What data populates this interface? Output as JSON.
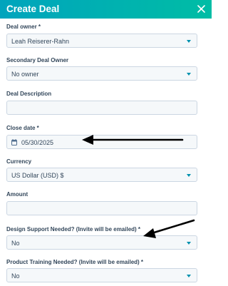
{
  "dialog": {
    "title": "Create Deal",
    "close_icon": "close-icon"
  },
  "fields": {
    "deal_owner": {
      "label": "Deal owner *",
      "value": "Leah Reiserer-Rahn"
    },
    "secondary_owner": {
      "label": "Secondary Deal Owner",
      "value": "No owner"
    },
    "description": {
      "label": "Deal Description",
      "value": ""
    },
    "close_date": {
      "label": "Close date *",
      "value": "05/30/2025",
      "icon": "calendar-icon"
    },
    "currency": {
      "label": "Currency",
      "value": "US Dollar (USD) $"
    },
    "amount": {
      "label": "Amount",
      "value": ""
    },
    "design_support": {
      "label": "Design Support Needed? (Invite will be emailed) *",
      "value": "No"
    },
    "product_training": {
      "label": "Product Training Needed? (Invite will be emailed) *",
      "value": "No"
    }
  },
  "colors": {
    "header_gradient_start": "#00a4bd",
    "header_gradient_end": "#00bda5",
    "field_bg": "#f5f8fa",
    "field_border": "#cbd6e2",
    "text": "#33475b",
    "caret": "#0091ae"
  }
}
